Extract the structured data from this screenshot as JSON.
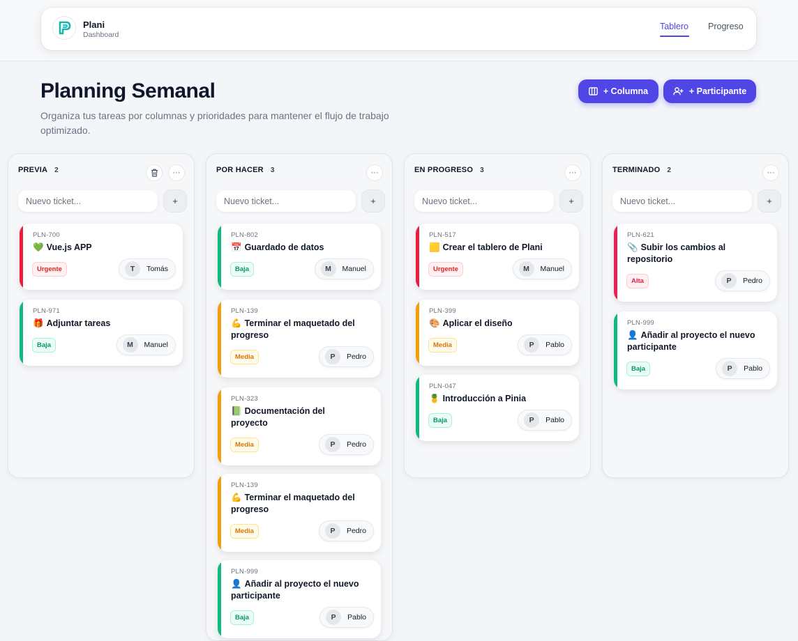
{
  "brand": {
    "name": "Plani",
    "subtitle": "Dashboard"
  },
  "nav": {
    "tabs": [
      {
        "label": "Tablero",
        "active": true
      },
      {
        "label": "Progreso",
        "active": false
      }
    ]
  },
  "page": {
    "title": "Planning Semanal",
    "subtitle": "Organiza tus tareas por columnas y prioridades para mantener el flujo de trabajo optimizado."
  },
  "actions": {
    "add_column": "+ Columna",
    "add_participant": "+ Participante"
  },
  "colors": {
    "accent": "#4f46e5",
    "priority": {
      "Urgente": "#ef1a3c",
      "Alta": "#ec1e55",
      "Media": "#f59e0b",
      "Baja": "#10b981"
    }
  },
  "new_ticket_placeholder": "Nuevo ticket...",
  "add_label": "+",
  "more_label": "···",
  "columns": [
    {
      "title": "PREVIA",
      "count": "2",
      "cards": [
        {
          "id": "PLN-700",
          "icon": "💚",
          "title": "Vue.js APP",
          "priority": "Urgente",
          "initial": "T",
          "assignee": "Tomás"
        },
        {
          "id": "PLN-971",
          "icon": "🎁",
          "title": "Adjuntar tareas",
          "priority": "Baja",
          "initial": "M",
          "assignee": "Manuel"
        }
      ]
    },
    {
      "title": "POR HACER",
      "count": "3",
      "cards": [
        {
          "id": "PLN-802",
          "icon": "📅",
          "title": "Guardado de datos",
          "priority": "Baja",
          "initial": "M",
          "assignee": "Manuel"
        },
        {
          "id": "PLN-139",
          "icon": "💪",
          "title": "Terminar el maquetado del progreso",
          "priority": "Media",
          "initial": "P",
          "assignee": "Pedro"
        },
        {
          "id": "PLN-323",
          "icon": "📗",
          "title": "Documentación del proyecto",
          "priority": "Media",
          "initial": "P",
          "assignee": "Pedro"
        },
        {
          "id": "PLN-139",
          "icon": "💪",
          "title": "Terminar el maquetado del progreso",
          "priority": "Media",
          "initial": "P",
          "assignee": "Pedro"
        },
        {
          "id": "PLN-999",
          "icon": "👤",
          "title": "Añadir al proyecto el nuevo participante",
          "priority": "Baja",
          "initial": "P",
          "assignee": "Pablo"
        }
      ]
    },
    {
      "title": "EN PROGRESO",
      "count": "3",
      "cards": [
        {
          "id": "PLN-517",
          "icon": "🟨",
          "title": "Crear el tablero de Plani",
          "priority": "Urgente",
          "initial": "M",
          "assignee": "Manuel"
        },
        {
          "id": "PLN-399",
          "icon": "🎨",
          "title": "Aplicar el diseño",
          "priority": "Media",
          "initial": "P",
          "assignee": "Pablo"
        },
        {
          "id": "PLN-047",
          "icon": "🍍",
          "title": "Introducción a Pinia",
          "priority": "Baja",
          "initial": "P",
          "assignee": "Pablo"
        }
      ]
    },
    {
      "title": "TERMINADO",
      "count": "2",
      "cards": [
        {
          "id": "PLN-621",
          "icon": "📎",
          "title": "Subir los cambios al repositorio",
          "priority": "Alta",
          "initial": "P",
          "assignee": "Pedro"
        },
        {
          "id": "PLN-999",
          "icon": "👤",
          "title": "Añadir al proyecto el nuevo participante",
          "priority": "Baja",
          "initial": "P",
          "assignee": "Pablo"
        }
      ]
    }
  ]
}
